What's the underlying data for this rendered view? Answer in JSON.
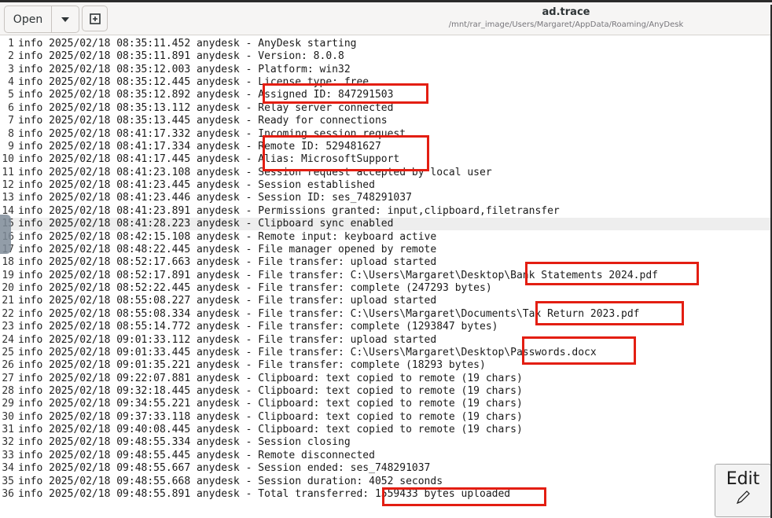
{
  "toolbar": {
    "open_label": "Open",
    "open_menu_icon": "chevron-down-icon",
    "new_tab_icon": "new-tab-icon"
  },
  "window": {
    "title": "ad.trace",
    "path": "/mnt/rar_image/Users/Margaret/AppData/Roaming/AnyDesk"
  },
  "editor": {
    "current_line": 15,
    "lines": [
      {
        "n": "1",
        "text": "info 2025/02/18 08:35:11.452 anydesk - AnyDesk starting"
      },
      {
        "n": "2",
        "text": "info 2025/02/18 08:35:11.891 anydesk - Version: 8.0.8"
      },
      {
        "n": "3",
        "text": "info 2025/02/18 08:35:12.003 anydesk - Platform: win32"
      },
      {
        "n": "4",
        "text": "info 2025/02/18 08:35:12.445 anydesk - License type: free"
      },
      {
        "n": "5",
        "text": "info 2025/02/18 08:35:12.892 anydesk - Assigned ID: 847291503"
      },
      {
        "n": "6",
        "text": "info 2025/02/18 08:35:13.112 anydesk - Relay server connected"
      },
      {
        "n": "7",
        "text": "info 2025/02/18 08:35:13.445 anydesk - Ready for connections"
      },
      {
        "n": "8",
        "text": "info 2025/02/18 08:41:17.332 anydesk - Incoming session request"
      },
      {
        "n": "9",
        "text": "info 2025/02/18 08:41:17.334 anydesk - Remote ID: 529481627"
      },
      {
        "n": "10",
        "text": "info 2025/02/18 08:41:17.445 anydesk - Alias: MicrosoftSupport"
      },
      {
        "n": "11",
        "text": "info 2025/02/18 08:41:23.108 anydesk - Session request accepted by local user"
      },
      {
        "n": "12",
        "text": "info 2025/02/18 08:41:23.445 anydesk - Session established"
      },
      {
        "n": "13",
        "text": "info 2025/02/18 08:41:23.446 anydesk - Session ID: ses_748291037"
      },
      {
        "n": "14",
        "text": "info 2025/02/18 08:41:23.891 anydesk - Permissions granted: input,clipboard,filetransfer"
      },
      {
        "n": "15",
        "text": "info 2025/02/18 08:41:28.223 anydesk - Clipboard sync enabled"
      },
      {
        "n": "16",
        "text": "info 2025/02/18 08:42:15.108 anydesk - Remote input: keyboard active"
      },
      {
        "n": "17",
        "text": "info 2025/02/18 08:48:22.445 anydesk - File manager opened by remote"
      },
      {
        "n": "18",
        "text": "info 2025/02/18 08:52:17.663 anydesk - File transfer: upload started"
      },
      {
        "n": "19",
        "text": "info 2025/02/18 08:52:17.891 anydesk - File transfer: C:\\Users\\Margaret\\Desktop\\Bank Statements 2024.pdf"
      },
      {
        "n": "20",
        "text": "info 2025/02/18 08:52:22.445 anydesk - File transfer: complete (247293 bytes)"
      },
      {
        "n": "21",
        "text": "info 2025/02/18 08:55:08.227 anydesk - File transfer: upload started"
      },
      {
        "n": "22",
        "text": "info 2025/02/18 08:55:08.334 anydesk - File transfer: C:\\Users\\Margaret\\Documents\\Tax Return 2023.pdf"
      },
      {
        "n": "23",
        "text": "info 2025/02/18 08:55:14.772 anydesk - File transfer: complete (1293847 bytes)"
      },
      {
        "n": "24",
        "text": "info 2025/02/18 09:01:33.112 anydesk - File transfer: upload started"
      },
      {
        "n": "25",
        "text": "info 2025/02/18 09:01:33.445 anydesk - File transfer: C:\\Users\\Margaret\\Desktop\\Passwords.docx"
      },
      {
        "n": "26",
        "text": "info 2025/02/18 09:01:35.221 anydesk - File transfer: complete (18293 bytes)"
      },
      {
        "n": "27",
        "text": "info 2025/02/18 09:22:07.881 anydesk - Clipboard: text copied to remote (19 chars)"
      },
      {
        "n": "28",
        "text": "info 2025/02/18 09:32:18.445 anydesk - Clipboard: text copied to remote (19 chars)"
      },
      {
        "n": "29",
        "text": "info 2025/02/18 09:34:55.221 anydesk - Clipboard: text copied to remote (19 chars)"
      },
      {
        "n": "30",
        "text": "info 2025/02/18 09:37:33.118 anydesk - Clipboard: text copied to remote (19 chars)"
      },
      {
        "n": "31",
        "text": "info 2025/02/18 09:40:08.445 anydesk - Clipboard: text copied to remote (19 chars)"
      },
      {
        "n": "32",
        "text": "info 2025/02/18 09:48:55.334 anydesk - Session closing"
      },
      {
        "n": "33",
        "text": "info 2025/02/18 09:48:55.445 anydesk - Remote disconnected"
      },
      {
        "n": "34",
        "text": "info 2025/02/18 09:48:55.667 anydesk - Session ended: ses_748291037"
      },
      {
        "n": "35",
        "text": "info 2025/02/18 09:48:55.668 anydesk - Session duration: 4052 seconds"
      },
      {
        "n": "36",
        "text": "info 2025/02/18 09:48:55.891 anydesk - Total transferred: 1559433 bytes uploaded"
      }
    ]
  },
  "annotations": {
    "color": "#e31e12",
    "boxes": [
      {
        "name": "assigned-id-highlight"
      },
      {
        "name": "remote-id-alias-highlight"
      },
      {
        "name": "bank-statements-highlight"
      },
      {
        "name": "tax-return-highlight"
      },
      {
        "name": "passwords-highlight"
      },
      {
        "name": "total-transferred-highlight"
      }
    ]
  },
  "edit_button": {
    "label": "Edit",
    "icon": "pencil-icon"
  }
}
